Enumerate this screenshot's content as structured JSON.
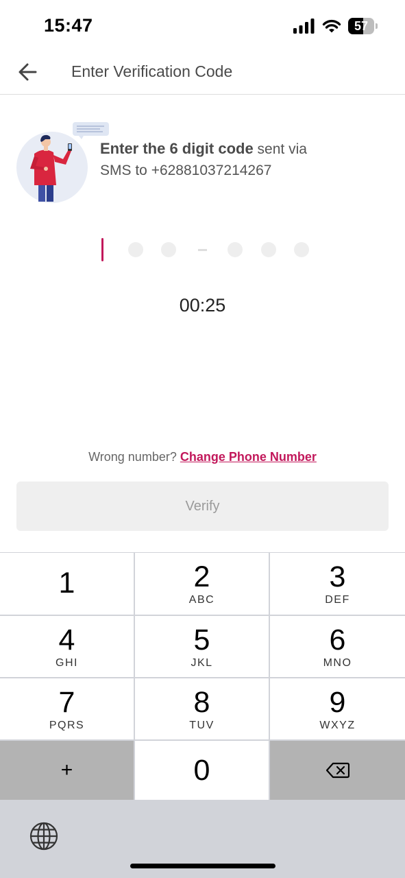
{
  "status_bar": {
    "time": "15:47",
    "battery_percent": "57",
    "battery_level": 0.57,
    "icons": [
      "signal-icon",
      "wifi-icon",
      "battery-icon"
    ]
  },
  "header": {
    "title": "Enter Verification Code",
    "back_icon": "arrow-left-icon"
  },
  "intro": {
    "bold_text": "Enter the 6 digit code",
    "sent_via": " sent via",
    "sms_to": "SMS to  +62881037214267"
  },
  "code": {
    "digits_entered": 0,
    "digit_count": 6
  },
  "timer": "00:25",
  "footer": {
    "wrong_number": "Wrong number?",
    "change_link": "Change Phone Number"
  },
  "verify_button": {
    "label": "Verify"
  },
  "keypad": {
    "keys": [
      {
        "digit": "1",
        "letters": ""
      },
      {
        "digit": "2",
        "letters": "ABC"
      },
      {
        "digit": "3",
        "letters": "DEF"
      },
      {
        "digit": "4",
        "letters": "GHI"
      },
      {
        "digit": "5",
        "letters": "JKL"
      },
      {
        "digit": "6",
        "letters": "MNO"
      },
      {
        "digit": "7",
        "letters": "PQRS"
      },
      {
        "digit": "8",
        "letters": "TUV"
      },
      {
        "digit": "9",
        "letters": "WXYZ"
      },
      {
        "digit": "+",
        "letters": ""
      },
      {
        "digit": "0",
        "letters": ""
      },
      {
        "digit": "",
        "letters": ""
      }
    ],
    "delete_icon": "backspace-icon",
    "globe_icon": "globe-icon"
  },
  "colors": {
    "accent": "#c2185b",
    "button_bg": "#efefef",
    "keypad_bg": "#d1d3d9"
  }
}
